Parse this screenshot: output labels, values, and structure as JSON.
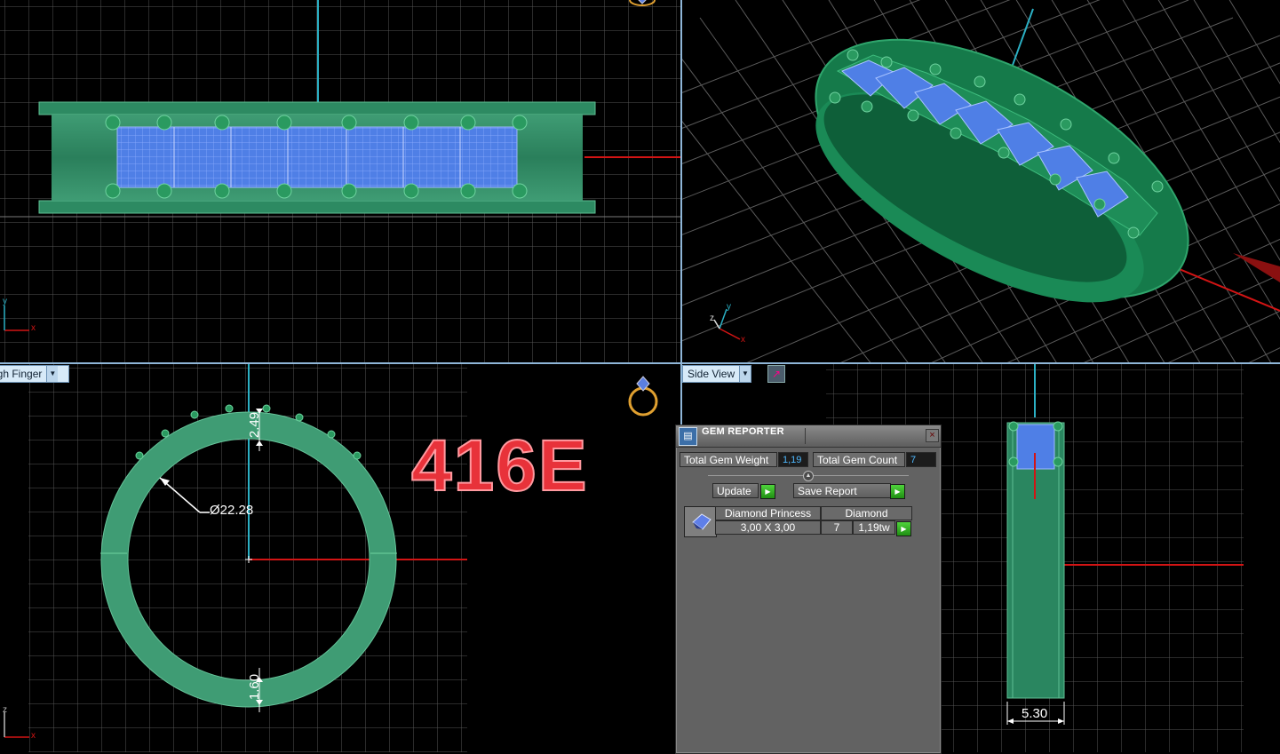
{
  "viewports": {
    "top_view_selector": "ugh Finger",
    "side_view_selector": "Side View"
  },
  "axes": {
    "front": {
      "y": "y",
      "x": "x"
    },
    "persp": {
      "y": "y",
      "x": "x",
      "z": "z"
    },
    "top": {
      "z": "z",
      "x": "x"
    }
  },
  "dimensions": {
    "diameter": "Ø22.28",
    "top_thickness": "2.49",
    "bottom_thickness": "1.60",
    "width": "5.30"
  },
  "model_label": "416E",
  "gem_reporter": {
    "title": "GEM REPORTER",
    "close_glyph": "×",
    "total_weight_label": "Total Gem Weight",
    "total_weight_value": "1,19",
    "total_count_label": "Total Gem Count",
    "total_count_value": "7",
    "update_label": "Update",
    "save_report_label": "Save Report",
    "gems": [
      {
        "name": "Diamond Princess",
        "material": "Diamond",
        "size": "3,00 X 3,00",
        "count": "7",
        "weight": "1,19tw"
      }
    ]
  },
  "colors": {
    "grid": "#5c5c5c",
    "band": "#1f8c5a",
    "gem": "#4f7fe6",
    "axis_red": "#d21414",
    "axis_cyan": "#2bb0c4",
    "label_red": "#e8323a"
  },
  "icons": [
    "ring-icon",
    "dropdown-arrow-icon",
    "cursor-tool-icon",
    "gem-reporter-app-icon",
    "close-icon",
    "play-icon",
    "princess-diamond-icon"
  ]
}
